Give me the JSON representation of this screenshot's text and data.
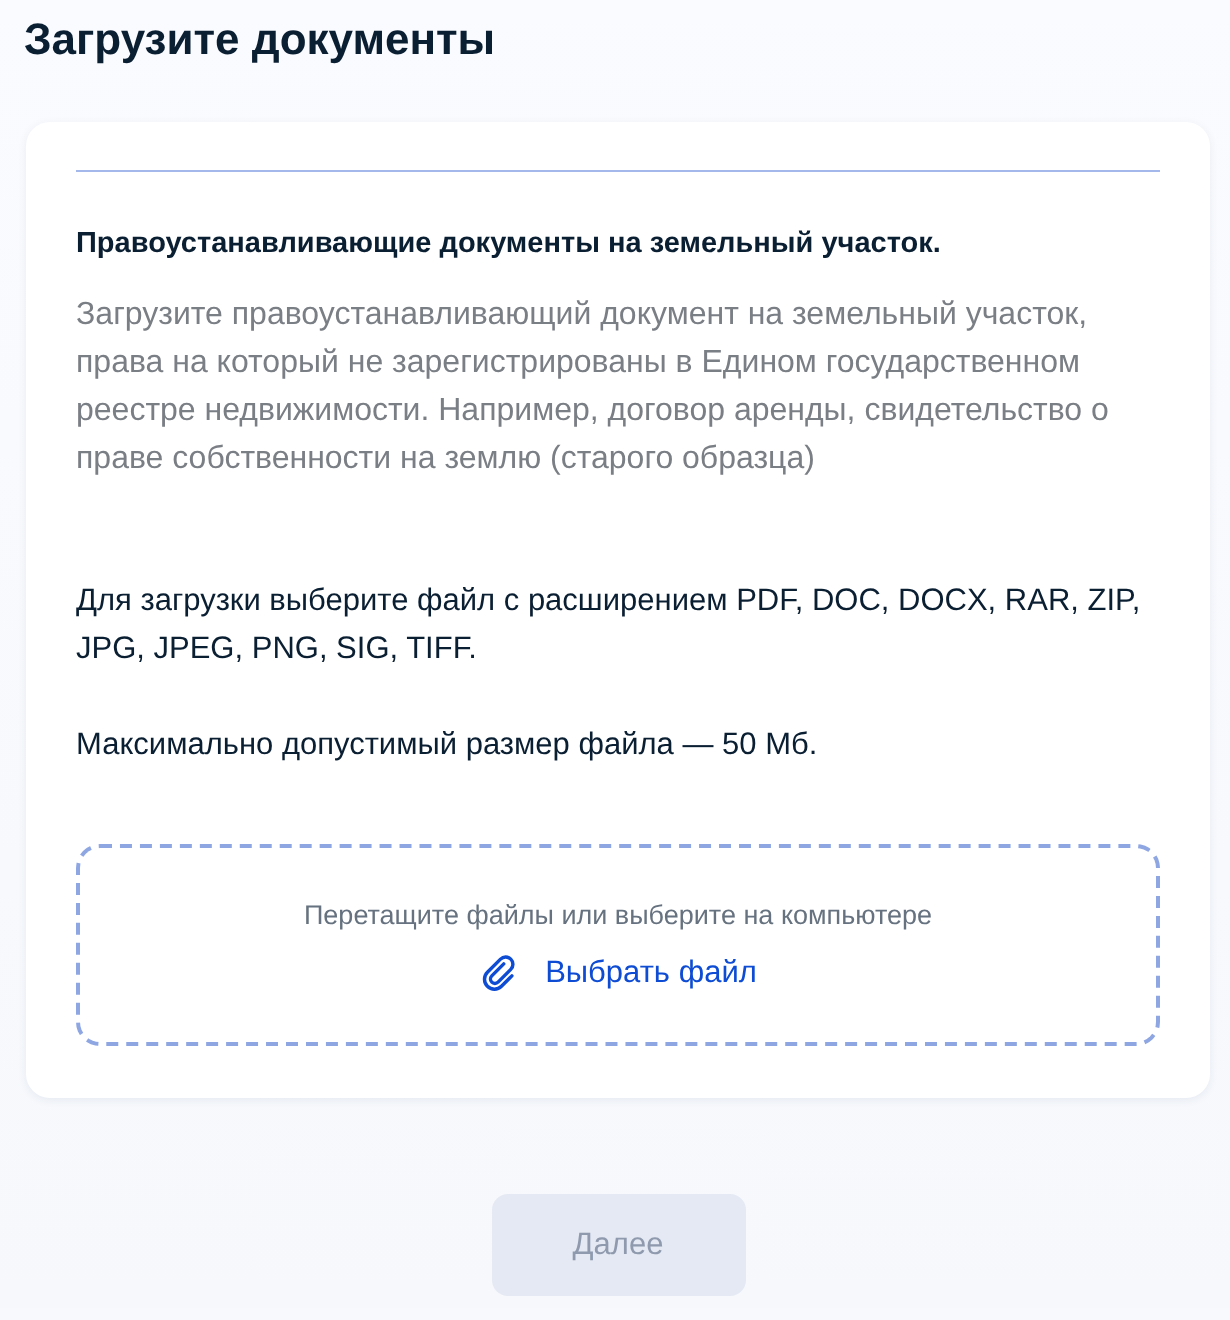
{
  "page_title": "Загрузите документы",
  "card": {
    "heading": "Правоустанавливающие документы на земельный участок.",
    "description": "Загрузите правоустанавливающий документ на земельный участок, права на который не зарегистрированы в Едином государственном реестре недвижимости. Например, договор аренды, свидетельство о праве собственности на землю (старого образца)",
    "formats_note": "Для загрузки выберите файл с расширением PDF, DOC, DOCX, RAR, ZIP, JPG, JPEG, PNG, SIG, TIFF.",
    "size_note": "Максимально допустимый размер файла — 50 Мб.",
    "dropzone": {
      "hint": "Перетащите файлы или выберите на компьютере",
      "link": "Выбрать файл"
    }
  },
  "next_button": {
    "label": "Далее",
    "disabled": true
  }
}
